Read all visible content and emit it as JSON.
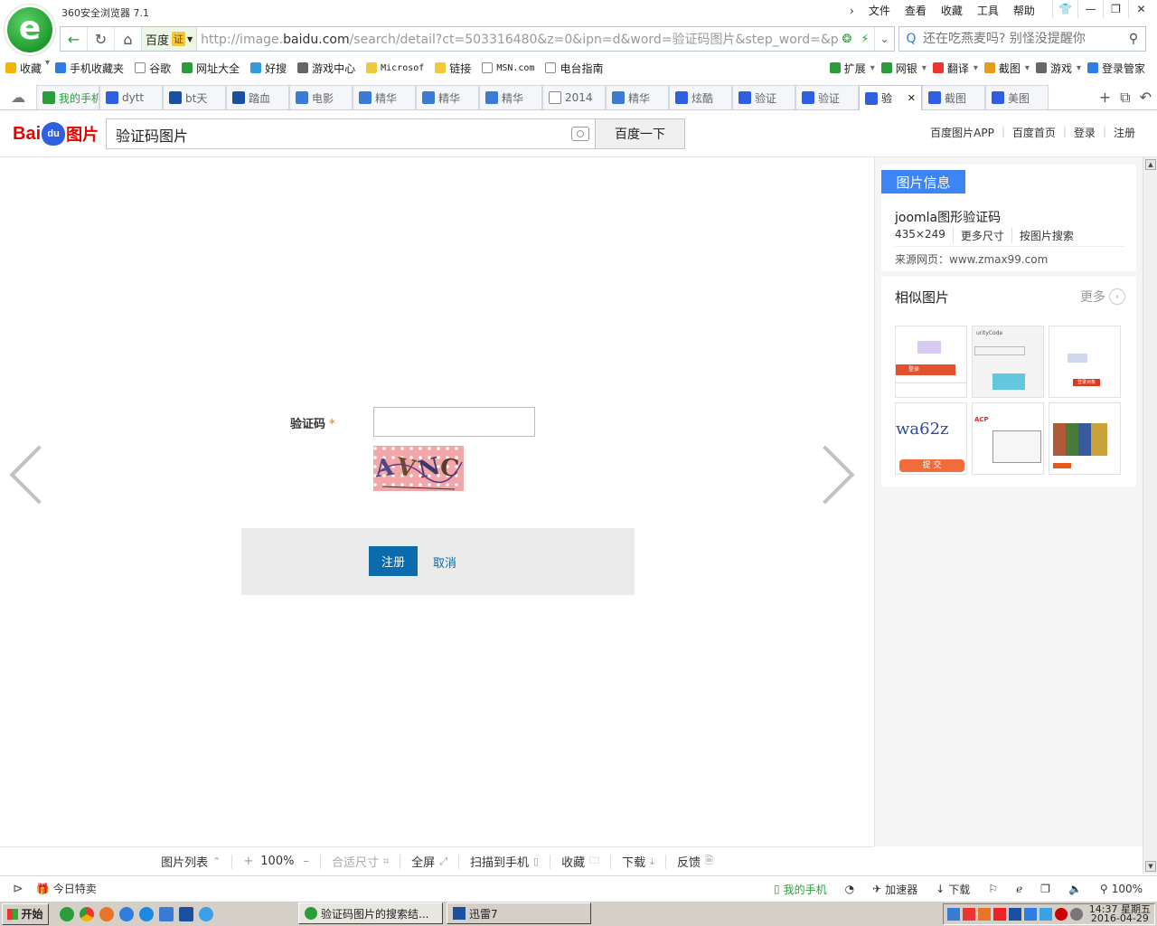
{
  "browser": {
    "title": "360安全浏览器 7.1",
    "menu": [
      "文件",
      "查看",
      "收藏",
      "工具",
      "帮助"
    ],
    "address": {
      "cert_label": "百度",
      "cert_tag": "证",
      "url_prefix": "http://image.",
      "url_domain": "baidu.com",
      "url_rest": "/search/detail?ct=503316480&z=0&ipn=d&word=验证码图片&step_word=&pn=2&"
    },
    "search_placeholder": "还在吃燕麦吗? 别怪没提醒你",
    "favorites_left": [
      {
        "label": "收藏",
        "icon": "star-icon",
        "color": "#f4b400"
      },
      {
        "label": "手机收藏夹",
        "icon": "phone-icon",
        "color": "#2f7de1"
      },
      {
        "label": "谷歌",
        "icon": "page-icon",
        "color": "#ffffff"
      },
      {
        "label": "网址大全",
        "icon": "globe-plus-icon",
        "color": "#2a9d3a"
      },
      {
        "label": "好搜",
        "icon": "haosou-icon",
        "color": "#2f9be1"
      },
      {
        "label": "游戏中心",
        "icon": "gamepad-icon",
        "color": "#666666"
      },
      {
        "label": "Microsof",
        "icon": "folder-icon",
        "color": "#f2c93a",
        "mono": true
      },
      {
        "label": "链接",
        "icon": "folder-icon",
        "color": "#f2c93a"
      },
      {
        "label": "MSN.com",
        "icon": "page-icon",
        "color": "#ffffff",
        "mono": true
      },
      {
        "label": "电台指南",
        "icon": "page-icon",
        "color": "#ffffff"
      }
    ],
    "favorites_right": [
      {
        "label": "扩展",
        "icon": "grid-icon",
        "color": "#2a9d3a"
      },
      {
        "label": "网银",
        "icon": "yen-icon",
        "color": "#2a9d3a"
      },
      {
        "label": "翻译",
        "icon": "translate-icon",
        "color": "#e33"
      },
      {
        "label": "截图",
        "icon": "scissors-icon",
        "color": "#e89a1c"
      },
      {
        "label": "游戏",
        "icon": "gamepad-icon",
        "color": "#666666"
      },
      {
        "label": "登录管家",
        "icon": "search-key-icon",
        "color": "#2f7de1"
      }
    ],
    "tabs": [
      {
        "label": "我的手机",
        "icon": "phone-icon",
        "color": "#2a9d3a",
        "style": "green"
      },
      {
        "label": "dytt",
        "icon": "baidu-paw-icon",
        "color": "#2f5ee0"
      },
      {
        "label": "bt天",
        "icon": "bt-icon",
        "color": "#1b4fa0"
      },
      {
        "label": "踏血",
        "icon": "bt-icon",
        "color": "#1b4fa0"
      },
      {
        "label": "电影",
        "icon": "grid-logo-icon",
        "color": "#3a7bd5"
      },
      {
        "label": "精华",
        "icon": "grid-logo-icon",
        "color": "#3a7bd5"
      },
      {
        "label": "精华",
        "icon": "grid-logo-icon",
        "color": "#3a7bd5"
      },
      {
        "label": "精华",
        "icon": "grid-logo-icon",
        "color": "#3a7bd5"
      },
      {
        "label": "2014",
        "icon": "page-icon",
        "color": "#ffffff"
      },
      {
        "label": "精华",
        "icon": "grid-logo-icon",
        "color": "#3a7bd5"
      },
      {
        "label": "炫酷",
        "icon": "baidu-paw-icon",
        "color": "#2f5ee0"
      },
      {
        "label": "验证",
        "icon": "baidu-paw-icon",
        "color": "#2f5ee0"
      },
      {
        "label": "验证",
        "icon": "baidu-paw-icon",
        "color": "#2f5ee0"
      },
      {
        "label": "验",
        "icon": "baidu-paw-icon",
        "color": "#2f5ee0",
        "style": "active"
      },
      {
        "label": "截图",
        "icon": "baidu-paw-icon",
        "color": "#2f5ee0"
      },
      {
        "label": "美图",
        "icon": "baidu-paw-icon",
        "color": "#2f5ee0"
      }
    ]
  },
  "baidu": {
    "logo_bai": "Bai",
    "logo_du": "du",
    "logo_pic": "图片",
    "query": "验证码图片",
    "search_button": "百度一下",
    "links": [
      "百度图片APP",
      "百度首页",
      "登录",
      "注册"
    ]
  },
  "image": {
    "label": "验证码",
    "required_mark": "*",
    "captcha_text": [
      "A",
      "V",
      "N",
      "C"
    ],
    "register_button": "注册",
    "cancel_link": "取消"
  },
  "info": {
    "tab": "图片信息",
    "title": "joomla图形验证码",
    "size": "435×249",
    "more_sizes": "更多尺寸",
    "search_by_image": "按图片搜索",
    "source": "来源网页：www.zmax99.com"
  },
  "similar": {
    "title": "相似图片",
    "more": "更多",
    "thumbs": [
      {
        "kind": "captcha-login",
        "accent": "#e3522e",
        "button_text": "登录"
      },
      {
        "kind": "captcha-field",
        "accent": "#63c7de",
        "header_text": "urityCode"
      },
      {
        "kind": "captcha-form",
        "accent": "#d9391e",
        "button_text": "登录对象"
      },
      {
        "kind": "captcha-submit",
        "accent": "#f26b3a",
        "button_text": "提 交",
        "captcha_text": "wa62z"
      },
      {
        "kind": "captcha-dialog",
        "accent": "#e22",
        "header_text": "ACP"
      },
      {
        "kind": "captcha-grid",
        "accent": "#e65a1e"
      }
    ]
  },
  "viewer_tools": {
    "list": "图片列表",
    "zoom": "100%",
    "fit": "合适尺寸",
    "fullscreen": "全屏",
    "scan": "扫描到手机",
    "collect": "收藏",
    "download": "下载",
    "feedback": "反馈"
  },
  "status": {
    "today": "今日特卖",
    "my_phone": "我的手机",
    "accelerator": "加速器",
    "download": "下载",
    "zoom": "100%"
  },
  "taskbar": {
    "start": "开始",
    "tasks": [
      "验证码图片的搜索结...",
      "迅雷7"
    ],
    "time": "14:37",
    "weekday": "星期五",
    "date": "2016-04-29"
  }
}
